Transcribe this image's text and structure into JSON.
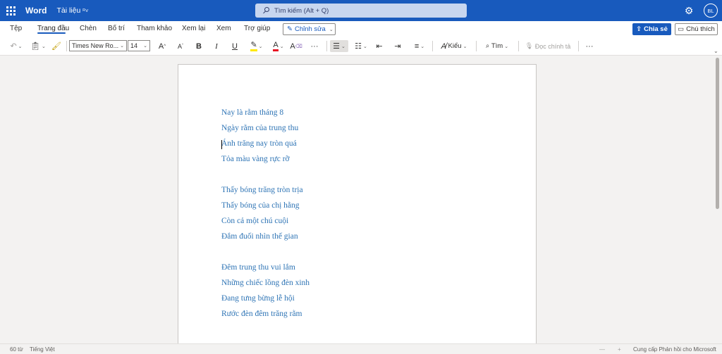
{
  "titlebar": {
    "app_name": "Word",
    "doc_name": "Tài liệu",
    "doc_name_suffix": "ᴿ˅",
    "search_placeholder": "Tìm kiếm (Alt + Q)",
    "gear_icon": "gear-icon",
    "avatar_initials": "BL"
  },
  "menu": {
    "items": [
      "Tệp",
      "Trang đầu",
      "Chèn",
      "Bố trí",
      "Tham khảo",
      "Xem lại",
      "Xem",
      "Trợ giúp"
    ],
    "active_item": "Trang đầu",
    "edit_mode_label": "Chỉnh sửa",
    "share_label": "Chia sẻ",
    "comments_label": "Chú thích"
  },
  "ribbon": {
    "font_name": "Times New Ro...",
    "font_size": "14",
    "grow_font": "A",
    "shrink_font": "A",
    "bold": "B",
    "italic": "I",
    "underline": "U",
    "font_color": "A",
    "clear_format": "A",
    "more": "···",
    "styles_label": "Kiểu",
    "find_label": "Tìm",
    "dictate_label": "Đọc chính tả",
    "more_end": "···"
  },
  "document": {
    "lines": [
      "Nay là rằm tháng 8",
      "Ngày rằm của trung thu",
      "Ánh trăng nay tròn quá",
      "Tỏa màu vàng rực rỡ",
      "",
      "Thấy bóng trăng tròn trịa",
      "Thấy bóng của chị hằng",
      "Còn cả một chú cuội",
      "Đắm đuối nhìn thế gian",
      "",
      "Đêm trung thu vui lắm",
      "Những chiếc lồng đèn xinh",
      "Đang tưng bừng lễ hội",
      "Rước đèn đêm trăng rằm"
    ],
    "text_color": "#2e74b5"
  },
  "statusbar": {
    "word_count": "60 từ",
    "language": "Tiếng Việt",
    "zoom_out": "—",
    "zoom_in": "+",
    "feedback": "Cung cấp Phản hồi cho Microsoft"
  },
  "colors": {
    "brand": "#185abd",
    "highlight": "#ffe900",
    "font_red": "#e81123"
  }
}
